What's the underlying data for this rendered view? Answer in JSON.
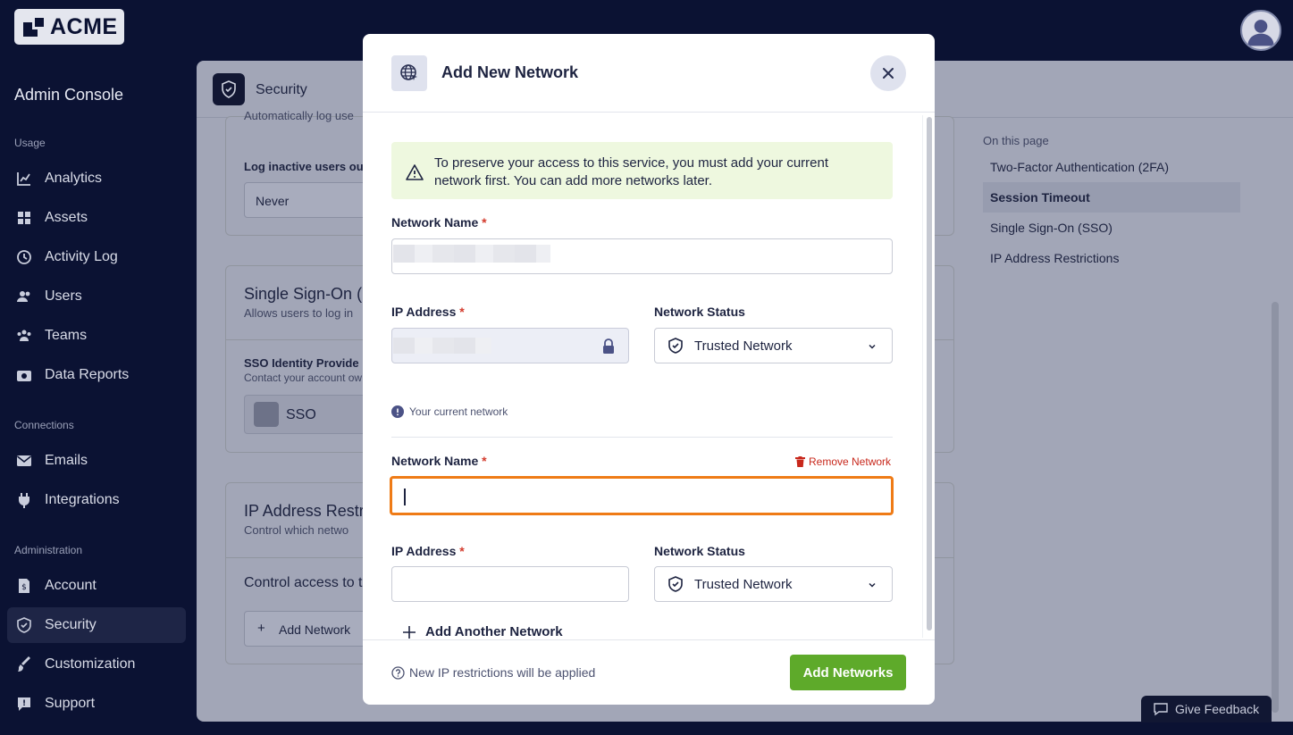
{
  "brand": {
    "logo_text": "ACME"
  },
  "sidebar": {
    "title": "Admin Console",
    "sections": [
      {
        "label": "Usage",
        "items": [
          "Analytics",
          "Assets",
          "Activity Log",
          "Users",
          "Teams",
          "Data Reports"
        ]
      },
      {
        "label": "Connections",
        "items": [
          "Emails",
          "Integrations"
        ]
      },
      {
        "label": "Administration",
        "items": [
          "Account",
          "Security",
          "Customization",
          "Support"
        ]
      }
    ],
    "active_item": "Security"
  },
  "page": {
    "title": "Security",
    "session_timeout": {
      "description_partial": "Automatically log use",
      "field_label_partial": "Log inactive users ou",
      "field_value": "Never"
    },
    "sso": {
      "title_partial": "Single Sign-On (",
      "description_partial": "Allows users to log in",
      "provider_label_partial": "SSO Identity Provide",
      "provider_desc_partial": "Contact your account ow",
      "provider_value": "SSO"
    },
    "ip_restrictions": {
      "title_partial": "IP Address Restr",
      "description_partial": "Control which netwo",
      "body_partial": "Control access to t",
      "add_button": "Add Network"
    },
    "toc": {
      "title": "On this page",
      "items": [
        "Two-Factor Authentication (2FA)",
        "Session Timeout",
        "Single Sign-On (SSO)",
        "IP Address Restrictions"
      ],
      "active": "Session Timeout"
    }
  },
  "feedback_label": "Give Feedback",
  "modal": {
    "title": "Add New Network",
    "alert": "To preserve your access to this service, you must add your current network first. You can add more networks later.",
    "networks": [
      {
        "name_label": "Network Name",
        "name_value": "",
        "ip_label": "IP Address",
        "ip_value": "",
        "ip_hint": "Your current network",
        "status_label": "Network Status",
        "status_value": "Trusted Network"
      },
      {
        "name_label": "Network Name",
        "name_value": "",
        "remove_label": "Remove Network",
        "ip_label": "IP Address",
        "ip_value": "",
        "status_label": "Network Status",
        "status_value": "Trusted Network"
      }
    ],
    "required_mark": "*",
    "add_another": "Add Another Network",
    "footer_note": "New IP restrictions will be applied",
    "submit": "Add Networks"
  },
  "colors": {
    "sidebar_bg": "#0b1233",
    "primary": "#5eaa2a",
    "danger": "#c8281c",
    "focus_ring": "#ef7b16",
    "alert_bg": "#eef8df"
  }
}
